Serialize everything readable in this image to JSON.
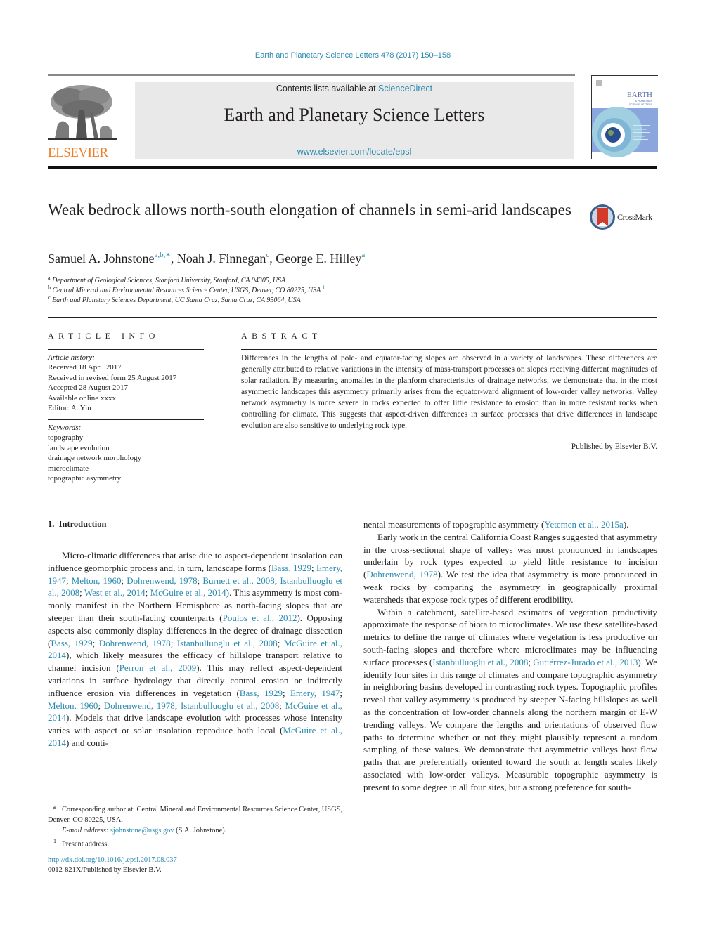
{
  "header": {
    "running_head": "Earth and Planetary Science Letters 478 (2017) 150–158",
    "contents_prefix": "Contents lists available at ",
    "contents_link": "ScienceDirect",
    "journal_title": "Earth and Planetary Science Letters",
    "journal_url": "www.elsevier.com/locate/epsl",
    "publisher_logo_text": "ELSEVIER",
    "cover_title": "EARTH",
    "cover_subtitle": "& PLANETARY SCIENCE LETTERS"
  },
  "colors": {
    "link": "#2a8ab0",
    "elsevier_orange": "#f07e26",
    "masthead_bg": "#e9e9e9",
    "text": "#231f20"
  },
  "article": {
    "title": "Weak bedrock allows north-south elongation of channels in semi-arid landscapes",
    "crossmark_label": "CrossMark",
    "authors": [
      {
        "name": "Samuel A. Johnstone",
        "marks": "a,b,∗"
      },
      {
        "name": "Noah J. Finnegan",
        "marks": "c"
      },
      {
        "name": "George E. Hilley",
        "marks": "a"
      }
    ],
    "affiliations": [
      {
        "mark": "a",
        "text": "Department of Geological Sciences, Stanford University, Stanford, CA 94305, USA",
        "note": ""
      },
      {
        "mark": "b",
        "text": "Central Mineral and Environmental Resources Science Center, USGS, Denver, CO 80225, USA",
        "note": "1"
      },
      {
        "mark": "c",
        "text": "Earth and Planetary Sciences Department, UC Santa Cruz, Santa Cruz, CA 95064, USA",
        "note": ""
      }
    ]
  },
  "article_info": {
    "heading": "ARTICLE INFO",
    "history_label": "Article history:",
    "history": [
      "Received 18 April 2017",
      "Received in revised form 25 August 2017",
      "Accepted 28 August 2017",
      "Available online xxxx",
      "Editor: A. Yin"
    ],
    "keywords_label": "Keywords:",
    "keywords": [
      "topography",
      "landscape evolution",
      "drainage network morphology",
      "microclimate",
      "topographic asymmetry"
    ]
  },
  "abstract": {
    "heading": "ABSTRACT",
    "text": "Differences in the lengths of pole- and equator-facing slopes are observed in a variety of landscapes. These differences are generally attributed to relative variations in the intensity of mass-transport processes on slopes receiving different magnitudes of solar radiation. By measuring anomalies in the planform characteristics of drainage networks, we demonstrate that in the most asymmetric landscapes this asymmetry primarily arises from the equator-ward alignment of low-order valley networks. Valley network asymmetry is more severe in rocks expected to offer little resistance to erosion than in more resistant rocks when controlling for climate. This suggests that aspect-driven differences in surface processes that drive differences in landscape evolution are also sensitive to underlying rock type.",
    "published_by": "Published by Elsevier B.V."
  },
  "introduction": {
    "heading": "1.  Introduction",
    "left_paragraph": [
      {
        "t": "Micro-climatic differences that arise due to aspect-dependent insolation can influence geomorphic process and, in turn, land­scape forms (",
        "link": false
      },
      {
        "t": "Bass, 1929",
        "link": true
      },
      {
        "t": "; ",
        "link": false
      },
      {
        "t": "Emery, 1947",
        "link": true
      },
      {
        "t": "; ",
        "link": false
      },
      {
        "t": "Melton, 1960",
        "link": true
      },
      {
        "t": "; ",
        "link": false
      },
      {
        "t": "Dohrenwend, 1978",
        "link": true
      },
      {
        "t": "; ",
        "link": false
      },
      {
        "t": "Burnett et al., 2008",
        "link": true
      },
      {
        "t": "; ",
        "link": false
      },
      {
        "t": "Istanbulluoglu et al., 2008",
        "link": true
      },
      {
        "t": "; ",
        "link": false
      },
      {
        "t": "West et al., 2014",
        "link": true
      },
      {
        "t": "; ",
        "link": false
      },
      {
        "t": "McGuire et al., 2014",
        "link": true
      },
      {
        "t": "). This asymmetry is most com­monly manifest in the Northern Hemisphere as north-facing slopes that are steeper than their south-facing counterparts (",
        "link": false
      },
      {
        "t": "Poulos et al., 2012",
        "link": true
      },
      {
        "t": "). Opposing aspects also commonly display differences in the degree of drainage dissection (",
        "link": false
      },
      {
        "t": "Bass, 1929",
        "link": true
      },
      {
        "t": "; ",
        "link": false
      },
      {
        "t": "Dohrenwend, 1978",
        "link": true
      },
      {
        "t": "; ",
        "link": false
      },
      {
        "t": "Istanbulluoglu et al., 2008",
        "link": true
      },
      {
        "t": "; ",
        "link": false
      },
      {
        "t": "McGuire et al., 2014",
        "link": true
      },
      {
        "t": "), which likely measures the efficacy of hillslope transport relative to channel incision (",
        "link": false
      },
      {
        "t": "Perron et al., 2009",
        "link": true
      },
      {
        "t": "). This may reflect aspect-dependent variations in surface hydrology that directly control erosion or in­directly influence erosion via differences in vegetation (",
        "link": false
      },
      {
        "t": "Bass, 1929",
        "link": true
      },
      {
        "t": "; ",
        "link": false
      },
      {
        "t": "Emery, 1947",
        "link": true
      },
      {
        "t": "; ",
        "link": false
      },
      {
        "t": "Melton, 1960",
        "link": true
      },
      {
        "t": "; ",
        "link": false
      },
      {
        "t": "Dohrenwend, 1978",
        "link": true
      },
      {
        "t": "; ",
        "link": false
      },
      {
        "t": "Istanbulluoglu et al., 2008",
        "link": true
      },
      {
        "t": "; ",
        "link": false
      },
      {
        "t": "McGuire et al., 2014",
        "link": true
      },
      {
        "t": "). Models that drive landscape evo­lution with processes whose intensity varies with aspect or solar insolation reproduce both local (",
        "link": false
      },
      {
        "t": "McGuire et al., 2014",
        "link": true
      },
      {
        "t": ") and conti-",
        "link": false
      }
    ],
    "right_paragraphs": [
      {
        "indent": false,
        "runs": [
          {
            "t": "nental measurements of topographic asymmetry (",
            "link": false
          },
          {
            "t": "Yetemen et al., 2015a",
            "link": true
          },
          {
            "t": ").",
            "link": false
          }
        ]
      },
      {
        "indent": true,
        "runs": [
          {
            "t": "Early work in the central California Coast Ranges suggested that asymmetry in the cross-sectional shape of valleys was most pro­nounced in landscapes underlain by rock types expected to yield little resistance to incision (",
            "link": false
          },
          {
            "t": "Dohrenwend, 1978",
            "link": true
          },
          {
            "t": "). We test the idea that asymmetry is more pronounced in weak rocks by comparing the asymmetry in geographically proximal watersheds that expose rock types of different erodibility.",
            "link": false
          }
        ]
      },
      {
        "indent": true,
        "runs": [
          {
            "t": "Within a catchment, satellite-based estimates of vegetation pro­ductivity approximate the response of biota to microclimates. We use these satellite-based metrics to define the range of climates where vegetation is less productive on south-facing slopes and therefore where microclimates may be influencing surface pro­cesses (",
            "link": false
          },
          {
            "t": "Istanbulluoglu et al., 2008",
            "link": true
          },
          {
            "t": "; ",
            "link": false
          },
          {
            "t": "Gutiérrez-Jurado et al., 2013",
            "link": true
          },
          {
            "t": "). We identify four sites in this range of climates and compare topo­graphic asymmetry in neighboring basins developed in contrasting rock types. Topographic profiles reveal that valley asymmetry is produced by steeper N-facing hillslopes as well as the concen­tration of low-order channels along the northern margin of E-W trending valleys. We compare the lengths and orientations of ob­served flow paths to determine whether or not they might plausi­bly represent a random sampling of these values. We demonstrate that asymmetric valleys host flow paths that are preferentially ori­ented toward the south at length scales likely associated with low-order valleys. Measurable topographic asymmetry is present to some degree in all four sites, but a strong preference for south-",
            "link": false
          }
        ]
      }
    ]
  },
  "footnotes": {
    "corresponding_mark": "*",
    "corresponding_text": "Corresponding author at: Central Mineral and Environmental Resources Science Center, USGS, Denver, CO 80225, USA.",
    "email_label": "E-mail address:",
    "email": "sjohnstone@usgs.gov",
    "email_suffix": " (S.A. Johnstone).",
    "present_mark": "1",
    "present_text": "Present address.",
    "doi": "http://dx.doi.org/10.1016/j.epsl.2017.08.037",
    "issn_line": "0012-821X/Published by Elsevier B.V."
  }
}
